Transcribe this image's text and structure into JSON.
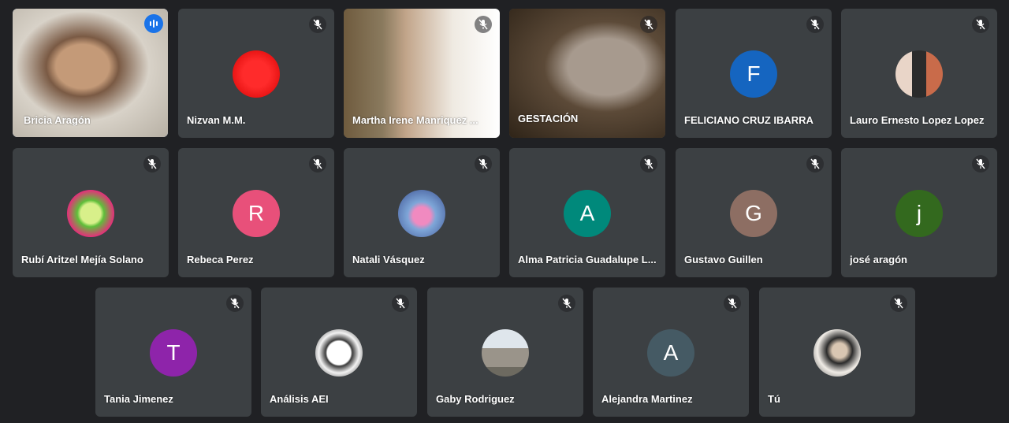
{
  "colors": {
    "background": "#202124",
    "tile": "#3c4043",
    "active_border": "#8ab4f8",
    "speaking_indicator": "#1a73e8"
  },
  "participants": [
    {
      "name": "Bricia Aragón",
      "type": "video",
      "speaking": true
    },
    {
      "name": "Nizvan M.M.",
      "type": "photo",
      "avatar_icon": "red-dots-avatar",
      "muted": true
    },
    {
      "name": "Martha Irene Manriquez ...",
      "type": "video",
      "muted": true
    },
    {
      "name": "GESTACIÓN",
      "type": "video",
      "muted": true
    },
    {
      "name": "FELICIANO CRUZ IBARRA",
      "type": "initial",
      "initial": "F",
      "avatar_color": "#1565c0",
      "muted": true
    },
    {
      "name": "Lauro Ernesto Lopez Lopez",
      "type": "photo",
      "avatar_icon": "person-photo-avatar",
      "muted": true
    },
    {
      "name": "Rubí Aritzel Mejía Solano",
      "type": "photo",
      "avatar_icon": "cartoon-avatar",
      "muted": true
    },
    {
      "name": "Rebeca Perez",
      "type": "initial",
      "initial": "R",
      "avatar_color": "#e8507a",
      "muted": true
    },
    {
      "name": "Natali Vásquez",
      "type": "photo",
      "avatar_icon": "person-photo-avatar",
      "muted": true
    },
    {
      "name": "Alma Patricia Guadalupe L...",
      "type": "initial",
      "initial": "A",
      "avatar_color": "#00897b",
      "muted": true
    },
    {
      "name": "Gustavo Guillen",
      "type": "initial",
      "initial": "G",
      "avatar_color": "#8d6e63",
      "muted": true
    },
    {
      "name": "josé aragón",
      "type": "initial",
      "initial": "j",
      "avatar_color": "#33691e",
      "muted": true
    },
    {
      "name": "Tania Jimenez",
      "type": "initial",
      "initial": "T",
      "avatar_color": "#8e24aa",
      "muted": true
    },
    {
      "name": "Análisis AEI",
      "type": "photo",
      "avatar_icon": "emblem-avatar",
      "muted": true
    },
    {
      "name": "Gaby Rodriguez",
      "type": "photo",
      "avatar_icon": "church-photo-avatar",
      "muted": true
    },
    {
      "name": "Alejandra Martinez",
      "type": "initial",
      "initial": "A",
      "avatar_color": "#455a64",
      "muted": true
    },
    {
      "name": "Tú",
      "type": "photo",
      "avatar_icon": "person-photo-avatar",
      "muted": true
    }
  ]
}
